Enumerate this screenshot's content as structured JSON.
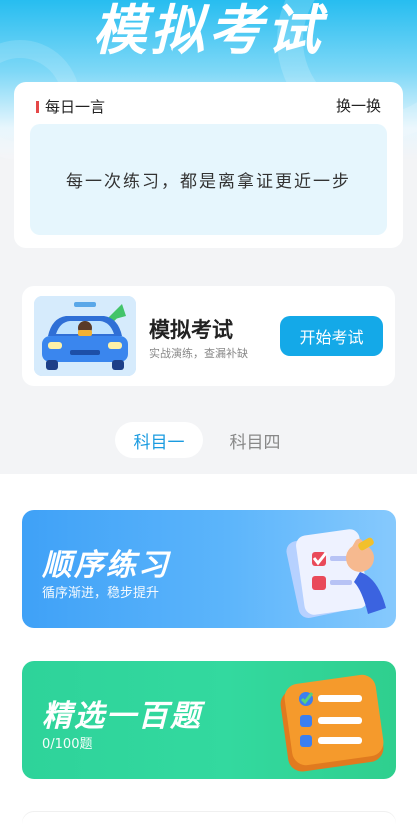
{
  "hero": {
    "title": "模拟考试"
  },
  "quote": {
    "header": "每日一言",
    "swap_label": "换一换",
    "text": "每一次练习，都是离拿证更近一步"
  },
  "exam": {
    "title": "模拟考试",
    "subtitle": "实战演练，查漏补缺",
    "button": "开始考试"
  },
  "tabs": [
    {
      "label": "科目一",
      "active": true
    },
    {
      "label": "科目四",
      "active": false
    }
  ],
  "cards": [
    {
      "title": "顺序练习",
      "subtitle": "循序渐进，稳步提升",
      "icon": "practice-icon"
    },
    {
      "title": "精选一百题",
      "subtitle": "0/100题",
      "icon": "checklist-icon"
    }
  ],
  "colors": {
    "accent": "#14a9e8",
    "blue_card": "#3fa1f7",
    "green_card": "#2ed39a",
    "quote_marker": "#e54848"
  }
}
